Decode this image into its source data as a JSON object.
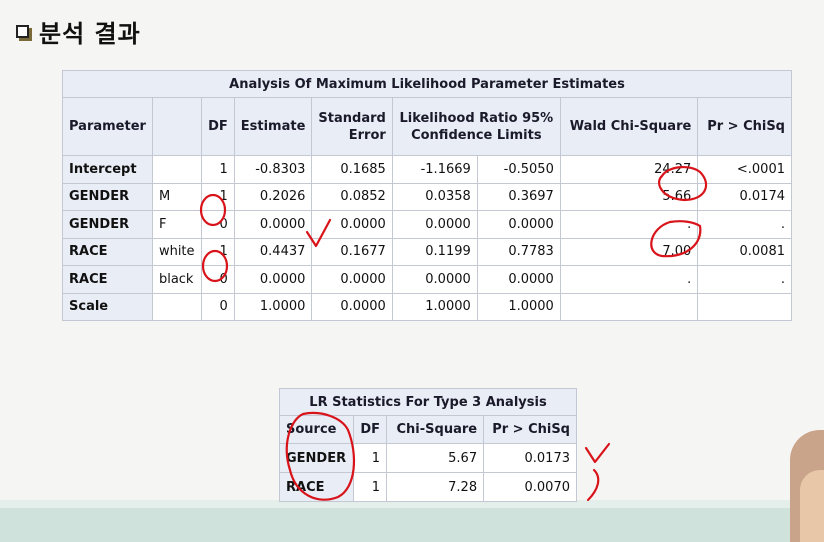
{
  "title": "분석 결과",
  "table1": {
    "caption": "Analysis Of Maximum Likelihood Parameter Estimates",
    "headers": {
      "parameter": "Parameter",
      "df": "DF",
      "estimate": "Estimate",
      "std_error_line1": "Standard",
      "std_error_line2": "Error",
      "lr_line1": "Likelihood Ratio 95%",
      "lr_line2": "Confidence Limits",
      "wald": "Wald Chi-Square",
      "pr": "Pr > ChiSq"
    },
    "rows": [
      {
        "param": "Intercept",
        "level": "",
        "df": "1",
        "estimate": "-0.8303",
        "se": "0.1685",
        "lower": "-1.1669",
        "upper": "-0.5050",
        "wald": "24.27",
        "pr": "<.0001"
      },
      {
        "param": "GENDER",
        "level": "M",
        "df": "1",
        "estimate": "0.2026",
        "se": "0.0852",
        "lower": "0.0358",
        "upper": "0.3697",
        "wald": "5.66",
        "pr": "0.0174"
      },
      {
        "param": "GENDER",
        "level": "F",
        "df": "0",
        "estimate": "0.0000",
        "se": "0.0000",
        "lower": "0.0000",
        "upper": "0.0000",
        "wald": ".",
        "pr": "."
      },
      {
        "param": "RACE",
        "level": "white",
        "df": "1",
        "estimate": "0.4437",
        "se": "0.1677",
        "lower": "0.1199",
        "upper": "0.7783",
        "wald": "7.00",
        "pr": "0.0081"
      },
      {
        "param": "RACE",
        "level": "black",
        "df": "0",
        "estimate": "0.0000",
        "se": "0.0000",
        "lower": "0.0000",
        "upper": "0.0000",
        "wald": ".",
        "pr": "."
      },
      {
        "param": "Scale",
        "level": "",
        "df": "0",
        "estimate": "1.0000",
        "se": "0.0000",
        "lower": "1.0000",
        "upper": "1.0000",
        "wald": "",
        "pr": ""
      }
    ]
  },
  "table2": {
    "caption": "LR Statistics For Type 3 Analysis",
    "headers": {
      "source": "Source",
      "df": "DF",
      "chisq": "Chi-Square",
      "pr": "Pr > ChiSq"
    },
    "rows": [
      {
        "source": "GENDER",
        "df": "1",
        "chisq": "5.67",
        "pr": "0.0173"
      },
      {
        "source": "RACE",
        "df": "1",
        "chisq": "7.28",
        "pr": "0.0070"
      }
    ]
  },
  "annotation_color": "#d8141a"
}
